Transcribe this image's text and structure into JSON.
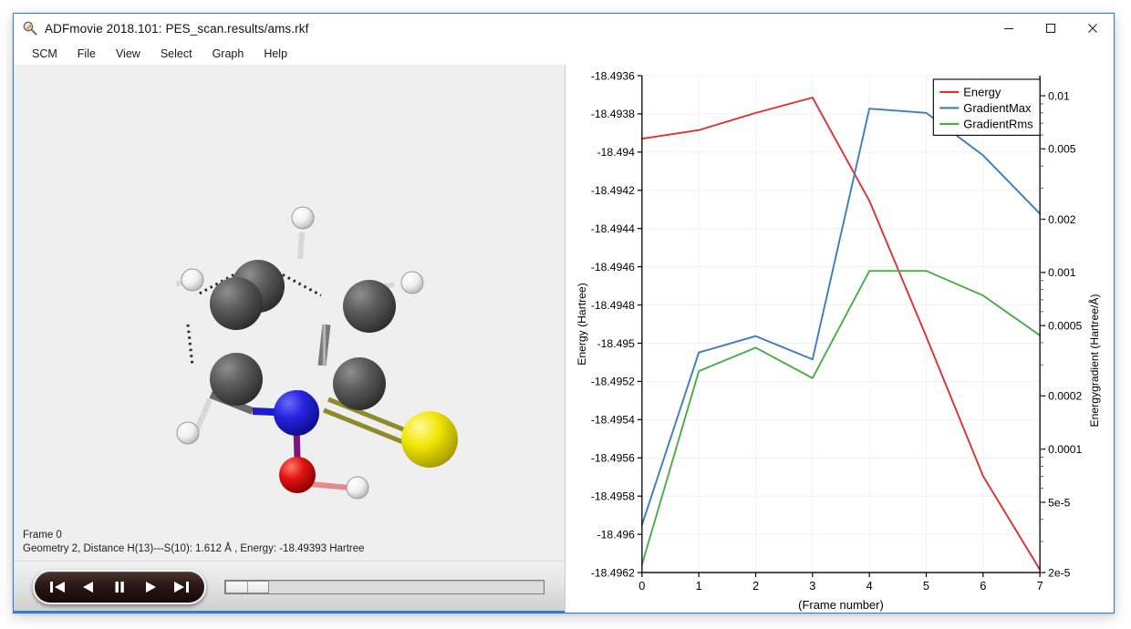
{
  "window": {
    "title": "ADFmovie 2018.101: PES_scan.results/ams.rkf",
    "icon": "magnifier-icon",
    "minimize_label": "–",
    "maximize_label": "□",
    "close_label": "✕"
  },
  "menubar": {
    "items": [
      {
        "label": "SCM"
      },
      {
        "label": "File"
      },
      {
        "label": "View"
      },
      {
        "label": "Select"
      },
      {
        "label": "Graph"
      },
      {
        "label": "Help"
      }
    ]
  },
  "viewer": {
    "status_line1": "Frame 0",
    "status_line2": "Geometry 2, Distance H(13)---S(10): 1.612 Å , Energy: -18.49393 Hartree",
    "background_color": "#efefef",
    "atom_colors": {
      "carbon": "#4d4d4d",
      "nitrogen": "#1d1dd0",
      "oxygen": "#e01010",
      "sulfur": "#f2e606",
      "hydrogen": "#ffffff"
    }
  },
  "transport": {
    "buttons": [
      {
        "name": "skip-to-start-button",
        "icon": "skip-back-icon"
      },
      {
        "name": "step-back-button",
        "icon": "rewind-icon"
      },
      {
        "name": "pause-button",
        "icon": "pause-icon"
      },
      {
        "name": "play-button",
        "icon": "play-icon"
      },
      {
        "name": "skip-to-end-button",
        "icon": "skip-forward-icon"
      }
    ],
    "slider_value": 0
  },
  "chart_data": {
    "type": "line",
    "title": "",
    "xlabel": "(Frame number)",
    "ylabel": "Energy (Hartree)",
    "y2label": "Energygradient (Hartree/Å)",
    "x": [
      0,
      1,
      2,
      3,
      4,
      5,
      6,
      7
    ],
    "xticks": [
      "0",
      "1",
      "2",
      "3",
      "4",
      "5",
      "6",
      "7"
    ],
    "xlim": [
      0,
      7
    ],
    "grid": true,
    "legend_position": "top-right",
    "left_axis": {
      "scale": "linear",
      "ticks": [
        -18.4936,
        -18.4938,
        -18.494,
        -18.4942,
        -18.4944,
        -18.4946,
        -18.4948,
        -18.495,
        -18.4952,
        -18.4954,
        -18.4956,
        -18.4958,
        -18.496,
        -18.4962
      ],
      "ticklabels": [
        "-18.4936",
        "-18.4938",
        "-18.494",
        "-18.4942",
        "-18.4944",
        "-18.4946",
        "-18.4948",
        "-18.495",
        "-18.4952",
        "-18.4954",
        "-18.4956",
        "-18.4958",
        "-18.496",
        "-18.4962"
      ],
      "ylim": [
        -18.4962,
        -18.4936
      ]
    },
    "right_axis": {
      "scale": "log",
      "ticks": [
        0.01,
        0.005,
        0.002,
        0.001,
        0.0005,
        0.0002,
        0.0001,
        5e-05,
        2e-05
      ],
      "ticklabels": [
        "0.01",
        "0.005",
        "0.002",
        "0.001",
        "0.0005",
        "0.0002",
        "0.0001",
        "5e-5",
        "2e-5"
      ],
      "ylim": [
        2e-05,
        0.013
      ]
    },
    "series": [
      {
        "name": "Energy",
        "color": "#e03030",
        "axis": "left",
        "values": [
          -18.49393,
          -18.493885,
          -18.493795,
          -18.493715,
          -18.494255,
          -18.494965,
          -18.495695,
          -18.496185
        ]
      },
      {
        "name": "GradientMax",
        "color": "#3c7cc0",
        "axis": "right",
        "values": [
          3.72e-05,
          0.000352,
          0.000436,
          0.000322,
          0.00845,
          0.008,
          0.0046,
          0.00215
        ]
      },
      {
        "name": "GradientRms",
        "color": "#4aad4a",
        "axis": "right",
        "values": [
          2.22e-05,
          0.000276,
          0.000375,
          0.000252,
          0.00102,
          0.00102,
          0.00074,
          0.00044
        ]
      }
    ],
    "legend": [
      {
        "label": "Energy",
        "color": "#e03030"
      },
      {
        "label": "GradientMax",
        "color": "#3c7cc0"
      },
      {
        "label": "GradientRms",
        "color": "#4aad4a"
      }
    ]
  }
}
